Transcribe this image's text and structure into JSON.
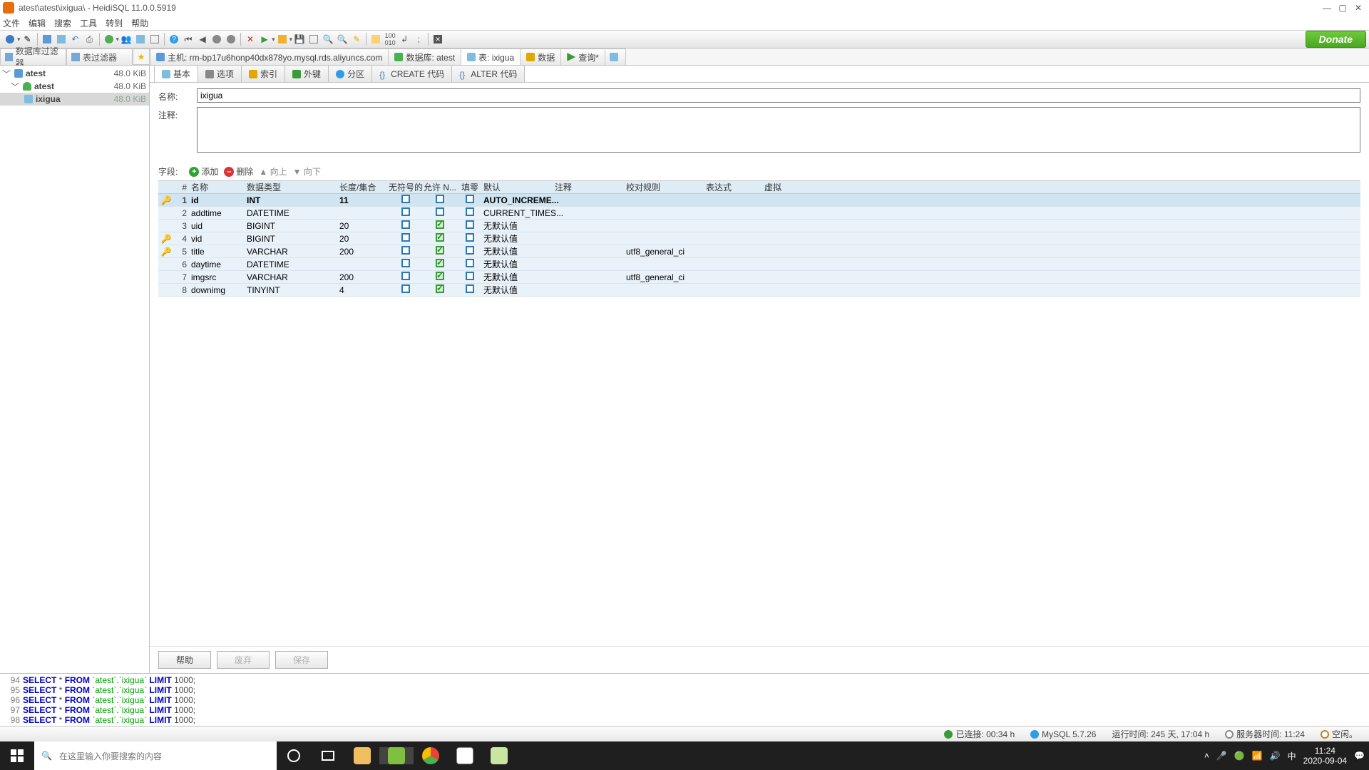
{
  "window": {
    "title": "atest\\atest\\ixigua\\ - HeidiSQL 11.0.0.5919"
  },
  "menu": {
    "file": "文件",
    "edit": "编辑",
    "search": "搜索",
    "tools": "工具",
    "goto": "转到",
    "help": "帮助"
  },
  "donate": "Donate",
  "filter_tabs": {
    "db": "数据库过滤器",
    "table": "表过滤器"
  },
  "main_tabs": {
    "host": "主机: rm-bp17u6honp40dx878yo.mysql.rds.aliyuncs.com",
    "db": "数据库: atest",
    "table": "表: ixigua",
    "data": "数据",
    "query": "查询*"
  },
  "tree": {
    "root": {
      "name": "atest",
      "size": "48.0 KiB"
    },
    "db": {
      "name": "atest",
      "size": "48.0 KiB"
    },
    "tbl": {
      "name": "ixigua",
      "size": "48.0 KiB"
    }
  },
  "sub_tabs": {
    "basic": "基本",
    "options": "选项",
    "index": "索引",
    "fk": "外键",
    "part": "分区",
    "create": "CREATE 代码",
    "alter": "ALTER 代码"
  },
  "form": {
    "name_label": "名称:",
    "comment_label": "注释:",
    "name_value": "ixigua",
    "comment_value": ""
  },
  "fields_bar": {
    "label": "字段:",
    "add": "添加",
    "remove": "删除",
    "up": "向上",
    "down": "向下"
  },
  "grid_headers": {
    "num": "#",
    "name": "名称",
    "type": "数据类型",
    "len": "长度/集合",
    "unsigned": "无符号的",
    "nullable": "允许 N...",
    "zerofill": "填零",
    "default": "默认",
    "comment": "注释",
    "collation": "校对规则",
    "expr": "表达式",
    "virtual": "虚拟"
  },
  "columns": [
    {
      "key": "pk",
      "num": "1",
      "name": "id",
      "type": "INT",
      "len": "11",
      "unsigned": false,
      "nullable": false,
      "zerofill": false,
      "default": "AUTO_INCREME...",
      "collation": ""
    },
    {
      "key": "",
      "num": "2",
      "name": "addtime",
      "type": "DATETIME",
      "len": "",
      "unsigned": false,
      "nullable": false,
      "zerofill": false,
      "default": "CURRENT_TIMES...",
      "collation": ""
    },
    {
      "key": "",
      "num": "3",
      "name": "uid",
      "type": "BIGINT",
      "len": "20",
      "unsigned": false,
      "nullable": true,
      "zerofill": false,
      "default": "无默认值",
      "collation": ""
    },
    {
      "key": "idx",
      "num": "4",
      "name": "vid",
      "type": "BIGINT",
      "len": "20",
      "unsigned": false,
      "nullable": true,
      "zerofill": false,
      "default": "无默认值",
      "collation": ""
    },
    {
      "key": "uni",
      "num": "5",
      "name": "title",
      "type": "VARCHAR",
      "len": "200",
      "unsigned": false,
      "nullable": true,
      "zerofill": false,
      "default": "无默认值",
      "collation": "utf8_general_ci"
    },
    {
      "key": "",
      "num": "6",
      "name": "daytime",
      "type": "DATETIME",
      "len": "",
      "unsigned": false,
      "nullable": true,
      "zerofill": false,
      "default": "无默认值",
      "collation": ""
    },
    {
      "key": "",
      "num": "7",
      "name": "imgsrc",
      "type": "VARCHAR",
      "len": "200",
      "unsigned": false,
      "nullable": true,
      "zerofill": false,
      "default": "无默认值",
      "collation": "utf8_general_ci"
    },
    {
      "key": "",
      "num": "8",
      "name": "downimg",
      "type": "TINYINT",
      "len": "4",
      "unsigned": false,
      "nullable": true,
      "zerofill": false,
      "default": "无默认值",
      "collation": ""
    }
  ],
  "buttons": {
    "help": "帮助",
    "discard": "废弃",
    "save": "保存"
  },
  "sql_log": [
    {
      "n": "94",
      "q": "SELECT * FROM `atest`.`ixigua` LIMIT 1000;"
    },
    {
      "n": "95",
      "q": "SELECT * FROM `atest`.`ixigua` LIMIT 1000;"
    },
    {
      "n": "96",
      "q": "SELECT * FROM `atest`.`ixigua` LIMIT 1000;"
    },
    {
      "n": "97",
      "q": "SELECT * FROM `atest`.`ixigua` LIMIT 1000;"
    },
    {
      "n": "98",
      "q": "SELECT * FROM `atest`.`ixigua` LIMIT 1000;"
    }
  ],
  "status": {
    "connected": "已连接: 00:34 h",
    "server": "MySQL 5.7.26",
    "uptime": "运行时间: 245 天, 17:04 h",
    "server_time": "服务器时间: 11:24",
    "idle": "空闲。"
  },
  "taskbar": {
    "search_placeholder": "在这里输入你要搜索的内容",
    "time": "11:24",
    "date": "2020-09-04",
    "ime": "中"
  }
}
